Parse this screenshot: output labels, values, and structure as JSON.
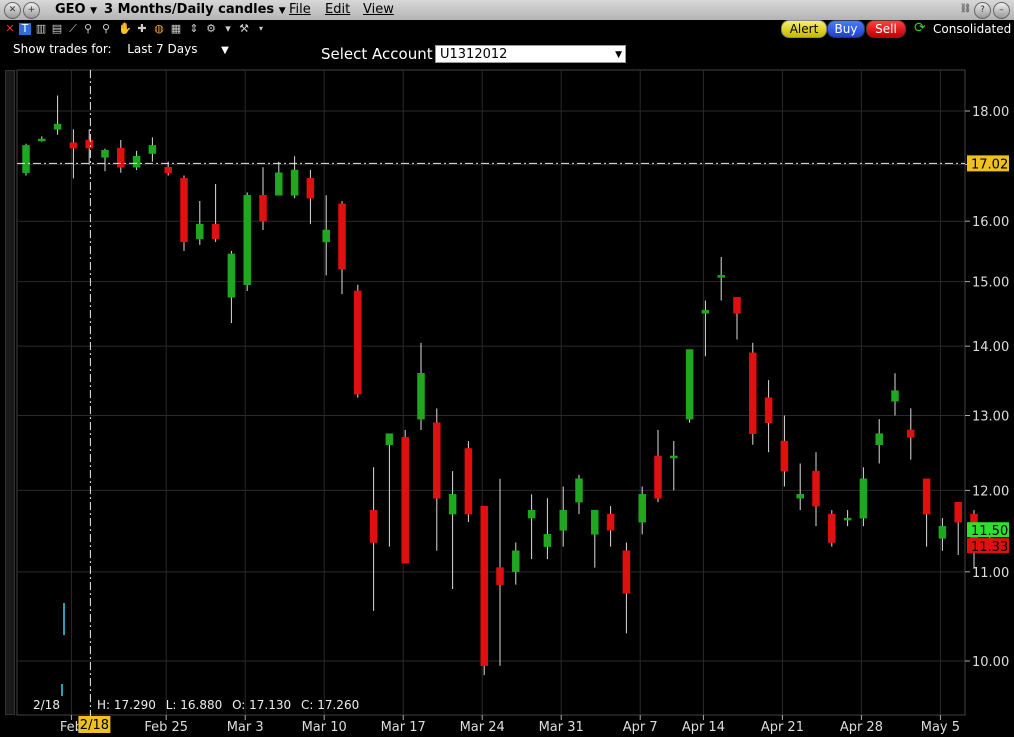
{
  "window": {
    "symbol": "GEO",
    "chart_type_label": "3 Months/Daily candles",
    "menus": [
      "File",
      "Edit",
      "View"
    ]
  },
  "toolbar": {
    "alert_label": "Alert",
    "buy_label": "Buy",
    "sell_label": "Sell",
    "consolidated_label": "Consolidated",
    "show_trades_label": "Show trades for:",
    "show_trades_value": "Last 7 Days",
    "select_account_label": "Select Account",
    "account_value": "U1312012"
  },
  "readout": {
    "date": "2/18",
    "hover_date": "2/18",
    "high": "H: 17.290",
    "low": "L: 16.880",
    "open": "O: 17.130",
    "close": "C: 17.260"
  },
  "colors": {
    "up": "#1fa81f",
    "down": "#e01010",
    "grid": "#2a2a2a",
    "crosshair": "#e8e8e8",
    "price_tag": "#f0c020",
    "bid_tag": "#30e030",
    "ask_tag": "#e01010"
  },
  "chart_data": {
    "type": "candlestick",
    "ylim": [
      9.55,
      18.6
    ],
    "yticks": [
      10,
      11,
      12,
      13,
      14,
      15,
      16,
      17,
      18
    ],
    "ytick_labels": [
      "10.00",
      "11.00",
      "12.00",
      "13.00",
      "14.00",
      "15.00",
      "16.00",
      "17.00",
      "18.00"
    ],
    "x_tick_labels": [
      {
        "label": "Feb",
        "index": 3
      },
      {
        "label": "Feb 25",
        "index": 9
      },
      {
        "label": "Mar 3",
        "index": 14
      },
      {
        "label": "Mar 10",
        "index": 19
      },
      {
        "label": "Mar 17",
        "index": 24
      },
      {
        "label": "Mar 24",
        "index": 29
      },
      {
        "label": "Mar 31",
        "index": 34
      },
      {
        "label": "Apr 7",
        "index": 39
      },
      {
        "label": "Apr 14",
        "index": 43
      },
      {
        "label": "Apr 21",
        "index": 48
      },
      {
        "label": "Apr 28",
        "index": 53
      },
      {
        "label": "May 5",
        "index": 58
      }
    ],
    "crosshair": {
      "index": 3,
      "price": 17.02,
      "price_label": "17.02"
    },
    "last_bid": {
      "price": 11.5,
      "label": "11.50"
    },
    "last_ask": {
      "price": 11.33,
      "label": "11.33"
    },
    "candles": [
      {
        "o": 16.85,
        "h": 17.38,
        "l": 16.8,
        "c": 17.35
      },
      {
        "o": 17.45,
        "h": 17.52,
        "l": 17.42,
        "c": 17.47
      },
      {
        "o": 17.65,
        "h": 18.3,
        "l": 17.55,
        "c": 17.75
      },
      {
        "o": 17.4,
        "h": 17.65,
        "l": 16.75,
        "c": 17.3
      },
      {
        "o": 17.45,
        "h": 17.65,
        "l": 17.0,
        "c": 17.3
      },
      {
        "o": 17.13,
        "h": 17.29,
        "l": 16.88,
        "c": 17.26
      },
      {
        "o": 17.3,
        "h": 17.45,
        "l": 16.85,
        "c": 16.95
      },
      {
        "o": 16.95,
        "h": 17.25,
        "l": 16.9,
        "c": 17.15
      },
      {
        "o": 17.2,
        "h": 17.5,
        "l": 17.05,
        "c": 17.35
      },
      {
        "o": 16.95,
        "h": 17.05,
        "l": 16.8,
        "c": 16.85
      },
      {
        "o": 16.75,
        "h": 16.8,
        "l": 15.5,
        "c": 15.65
      },
      {
        "o": 15.7,
        "h": 16.35,
        "l": 15.6,
        "c": 15.95
      },
      {
        "o": 15.95,
        "h": 16.65,
        "l": 15.65,
        "c": 15.7
      },
      {
        "o": 14.75,
        "h": 15.5,
        "l": 14.35,
        "c": 15.45
      },
      {
        "o": 14.95,
        "h": 16.5,
        "l": 14.85,
        "c": 16.45
      },
      {
        "o": 16.45,
        "h": 16.95,
        "l": 15.85,
        "c": 16.0
      },
      {
        "o": 16.45,
        "h": 17.05,
        "l": 16.45,
        "c": 16.85
      },
      {
        "o": 16.45,
        "h": 17.15,
        "l": 16.4,
        "c": 16.9
      },
      {
        "o": 16.75,
        "h": 16.9,
        "l": 15.95,
        "c": 16.4
      },
      {
        "o": 15.65,
        "h": 16.45,
        "l": 15.1,
        "c": 15.85
      },
      {
        "o": 16.3,
        "h": 16.35,
        "l": 14.8,
        "c": 15.2
      },
      {
        "o": 14.85,
        "h": 14.95,
        "l": 13.25,
        "c": 13.3
      },
      {
        "o": 11.75,
        "h": 12.3,
        "l": 10.55,
        "c": 11.35
      },
      {
        "o": 12.6,
        "h": 12.75,
        "l": 11.3,
        "c": 12.75
      },
      {
        "o": 12.7,
        "h": 12.8,
        "l": 11.2,
        "c": 11.1
      },
      {
        "o": 12.95,
        "h": 14.05,
        "l": 12.8,
        "c": 13.6
      },
      {
        "o": 12.9,
        "h": 13.1,
        "l": 11.25,
        "c": 11.9
      },
      {
        "o": 11.7,
        "h": 12.25,
        "l": 10.8,
        "c": 11.95
      },
      {
        "o": 12.55,
        "h": 12.65,
        "l": 11.6,
        "c": 11.7
      },
      {
        "o": 11.8,
        "h": 11.8,
        "l": 9.85,
        "c": 9.95
      },
      {
        "o": 11.05,
        "h": 12.15,
        "l": 9.95,
        "c": 10.85
      },
      {
        "o": 11.0,
        "h": 11.35,
        "l": 10.85,
        "c": 11.25
      },
      {
        "o": 11.65,
        "h": 11.95,
        "l": 11.15,
        "c": 11.75
      },
      {
        "o": 11.3,
        "h": 11.9,
        "l": 11.15,
        "c": 11.45
      },
      {
        "o": 11.5,
        "h": 12.05,
        "l": 11.3,
        "c": 11.75
      },
      {
        "o": 11.85,
        "h": 12.2,
        "l": 11.7,
        "c": 12.15
      },
      {
        "o": 11.45,
        "h": 11.75,
        "l": 11.05,
        "c": 11.75
      },
      {
        "o": 11.7,
        "h": 11.8,
        "l": 11.3,
        "c": 11.5
      },
      {
        "o": 11.25,
        "h": 11.35,
        "l": 10.3,
        "c": 10.75
      },
      {
        "o": 11.6,
        "h": 12.05,
        "l": 11.45,
        "c": 11.95
      },
      {
        "o": 12.45,
        "h": 12.8,
        "l": 11.85,
        "c": 11.9
      },
      {
        "o": 12.45,
        "h": 12.65,
        "l": 12.0,
        "c": 12.45
      },
      {
        "o": 12.95,
        "h": 13.95,
        "l": 12.9,
        "c": 13.95
      },
      {
        "o": 14.5,
        "h": 14.7,
        "l": 13.85,
        "c": 14.55
      },
      {
        "o": 15.1,
        "h": 15.4,
        "l": 14.7,
        "c": 15.1
      },
      {
        "o": 14.75,
        "h": 14.75,
        "l": 14.1,
        "c": 14.5
      },
      {
        "o": 13.9,
        "h": 14.05,
        "l": 12.6,
        "c": 12.75
      },
      {
        "o": 13.25,
        "h": 13.5,
        "l": 12.5,
        "c": 12.9
      },
      {
        "o": 12.65,
        "h": 13.0,
        "l": 12.05,
        "c": 12.25
      },
      {
        "o": 11.9,
        "h": 12.35,
        "l": 11.75,
        "c": 11.95
      },
      {
        "o": 12.25,
        "h": 12.5,
        "l": 11.55,
        "c": 11.8
      },
      {
        "o": 11.7,
        "h": 11.75,
        "l": 11.3,
        "c": 11.35
      },
      {
        "o": 11.65,
        "h": 11.75,
        "l": 11.55,
        "c": 11.65
      },
      {
        "o": 11.65,
        "h": 12.3,
        "l": 11.55,
        "c": 12.15
      },
      {
        "o": 12.6,
        "h": 12.95,
        "l": 12.35,
        "c": 12.75
      },
      {
        "o": 13.2,
        "h": 13.6,
        "l": 13.0,
        "c": 13.35
      },
      {
        "o": 12.8,
        "h": 13.1,
        "l": 12.4,
        "c": 12.7
      },
      {
        "o": 12.15,
        "h": 12.15,
        "l": 11.3,
        "c": 11.7
      },
      {
        "o": 11.4,
        "h": 11.65,
        "l": 11.25,
        "c": 11.55
      },
      {
        "o": 11.85,
        "h": 11.85,
        "l": 11.2,
        "c": 11.6
      },
      {
        "o": 11.7,
        "h": 11.75,
        "l": 11.05,
        "c": 11.25
      },
      {
        "o": 11.4,
        "h": 11.5,
        "l": 11.3,
        "c": 11.4
      }
    ],
    "volume_marks": [
      {
        "index": 2,
        "top": 0.15,
        "bottom": 0.0
      },
      {
        "index": 2,
        "top": 0.6,
        "bottom": 0.9
      }
    ]
  }
}
